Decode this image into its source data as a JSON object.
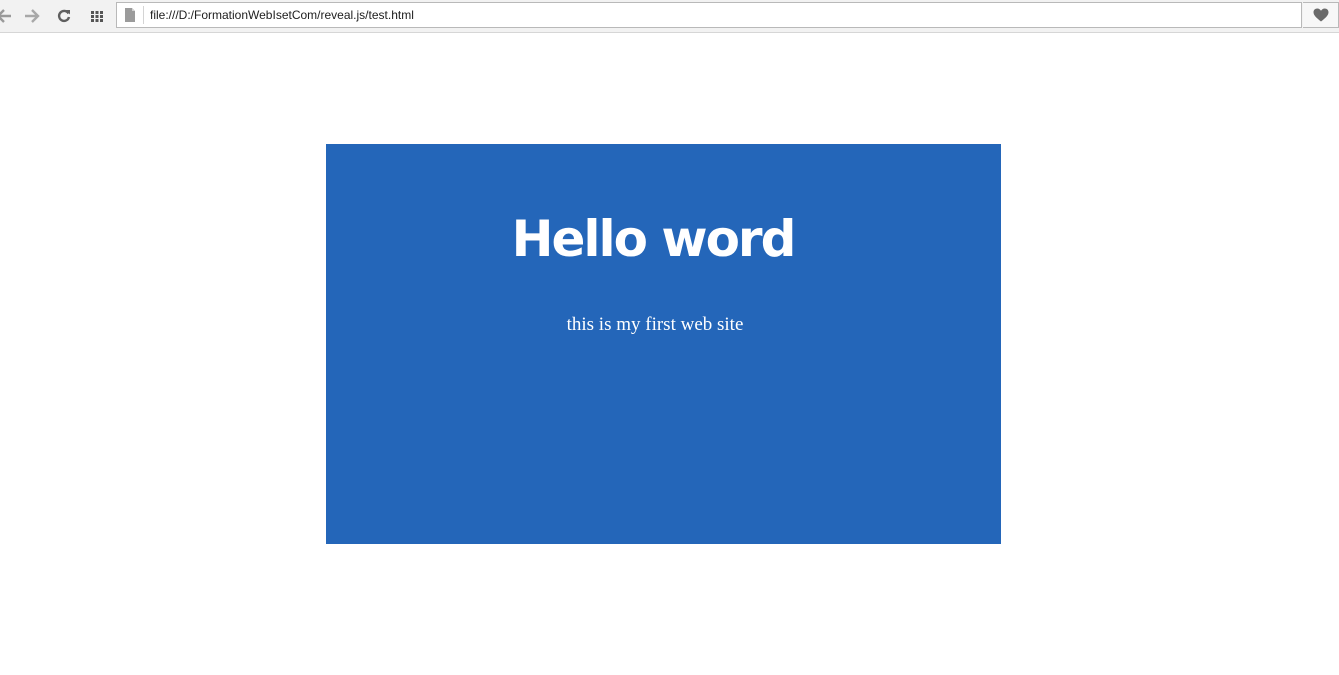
{
  "browser": {
    "url": "file:///D:/FormationWebIsetCom/reveal.js/test.html",
    "icons": {
      "back": "arrow-left-icon",
      "forward": "arrow-right-icon",
      "reload": "reload-icon",
      "apps": "grid-icon",
      "page": "file-icon",
      "favorite": "heart-icon"
    }
  },
  "slide": {
    "title": "Hello word",
    "subtitle": "this is my first web site",
    "background_color": "#2466b9"
  }
}
